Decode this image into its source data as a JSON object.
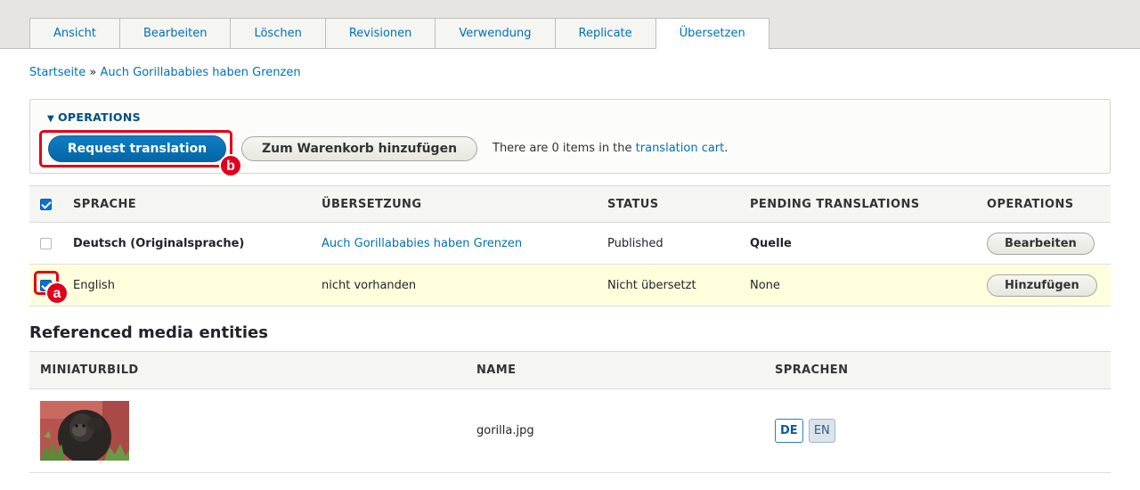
{
  "tabs": [
    {
      "label": "Ansicht"
    },
    {
      "label": "Bearbeiten"
    },
    {
      "label": "Löschen"
    },
    {
      "label": "Revisionen"
    },
    {
      "label": "Verwendung"
    },
    {
      "label": "Replicate"
    },
    {
      "label": "Übersetzen",
      "active": true
    }
  ],
  "breadcrumb": {
    "home": "Startseite",
    "separator": "»",
    "current": "Auch Gorillababies haben Grenzen"
  },
  "operations": {
    "title": "OPERATIONS",
    "request_button": "Request translation",
    "cart_button": "Zum Warenkorb hinzufügen",
    "cart_text_before": "There are 0 items in the ",
    "cart_link": "translation cart",
    "cart_text_after": "."
  },
  "annotations": {
    "a": "a",
    "b": "b",
    "color": "#e1001a"
  },
  "translations_table": {
    "headers": [
      "SPRACHE",
      "ÜBERSETZUNG",
      "STATUS",
      "PENDING TRANSLATIONS",
      "OPERATIONS"
    ],
    "select_all_checked": true,
    "rows": [
      {
        "checked": false,
        "language": "Deutsch (Originalsprache)",
        "translation": "Auch Gorillababies haben Grenzen",
        "status": "Published",
        "pending": "Quelle",
        "operation": "Bearbeiten"
      },
      {
        "checked": true,
        "language": "English",
        "translation": "nicht vorhanden",
        "status": "Nicht übersetzt",
        "pending": "None",
        "operation": "Hinzufügen"
      }
    ]
  },
  "media_section": {
    "title": "Referenced media entities",
    "headers": [
      "MINIATURBILD",
      "NAME",
      "SPRACHEN"
    ],
    "rows": [
      {
        "name": "gorilla.jpg",
        "languages": [
          "DE",
          "EN"
        ]
      }
    ]
  },
  "colors": {
    "link": "#0071b8",
    "primary_button": "#0a72b8",
    "highlight_row": "#ffffdd",
    "annotation_red": "#e1001a"
  }
}
